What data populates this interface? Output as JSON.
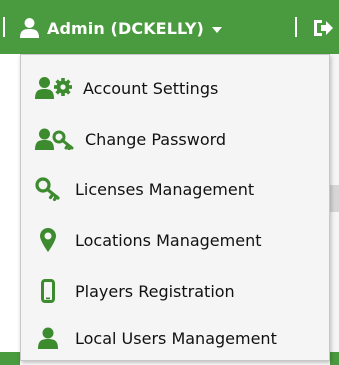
{
  "colors": {
    "nav_green": "#4a9a3f",
    "icon_green": "#3d8b2f",
    "menu_bg": "#f5f5f5",
    "text": "#111111"
  },
  "topbar": {
    "user_menu_label": "Admin (DCKELLY)",
    "user_icon": "user-icon",
    "logout_icon": "sign-out-icon"
  },
  "menu": {
    "items": [
      {
        "label": "Account Settings",
        "icon": "user-gear-icon"
      },
      {
        "label": "Change Password",
        "icon": "user-key-icon"
      },
      {
        "label": "Licenses Management",
        "icon": "key-icon"
      },
      {
        "label": "Locations Management",
        "icon": "map-marker-icon"
      },
      {
        "label": "Players Registration",
        "icon": "mobile-phone-icon"
      },
      {
        "label": "Local Users Management",
        "icon": "user-icon"
      }
    ]
  }
}
